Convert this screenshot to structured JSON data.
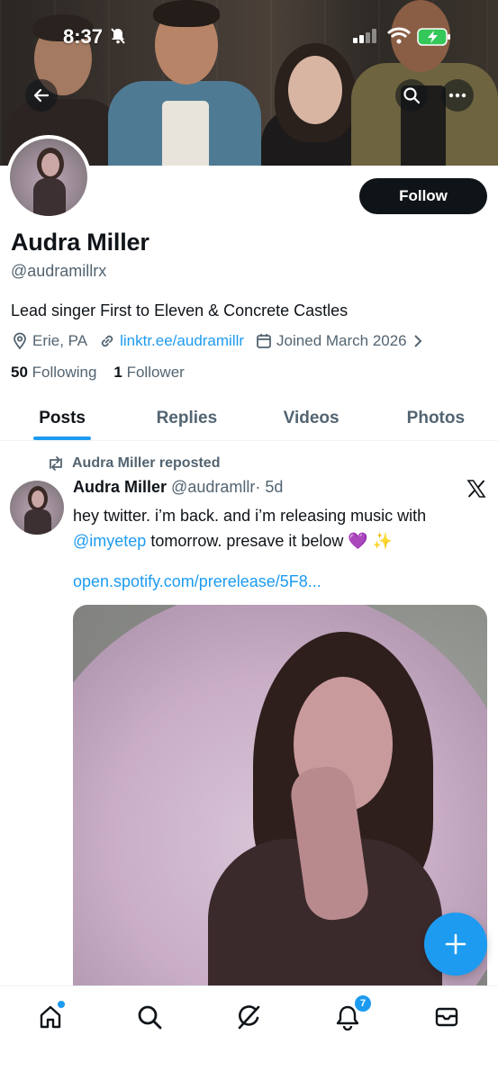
{
  "status_bar": {
    "time": "8:37"
  },
  "profile": {
    "name": "Audra Miller",
    "handle": "@audramillrx",
    "bio": "Lead singer First to Eleven & Concrete Castles",
    "location": "Erie, PA",
    "website": "linktr.ee/audramillr",
    "joined": "Joined March 2026",
    "following_count": "50",
    "following_label": "Following",
    "followers_count": "1",
    "followers_label": "Follower",
    "follow_button": "Follow"
  },
  "tabs": [
    {
      "label": "Posts",
      "active": true
    },
    {
      "label": "Replies",
      "active": false
    },
    {
      "label": "Videos",
      "active": false
    },
    {
      "label": "Photos",
      "active": false
    }
  ],
  "post": {
    "repost_label": "Audra Miller reposted",
    "author_name": "Audra Miller",
    "author_handle": "@audramllr",
    "time": "· 5d",
    "text_before_mention": "hey twitter. i’m back. and i’m releasing music with",
    "mention": "@imyetep",
    "text_after_mention": "tomorrow. presave it below 💜 ✨",
    "link": "open.spotify.com/prerelease/5F8..."
  },
  "nav": {
    "notifications_badge": "7"
  },
  "colors": {
    "accent": "#1d9bf0",
    "text": "#0f1419",
    "secondary": "#536471",
    "follow_bg": "#0f1419"
  }
}
